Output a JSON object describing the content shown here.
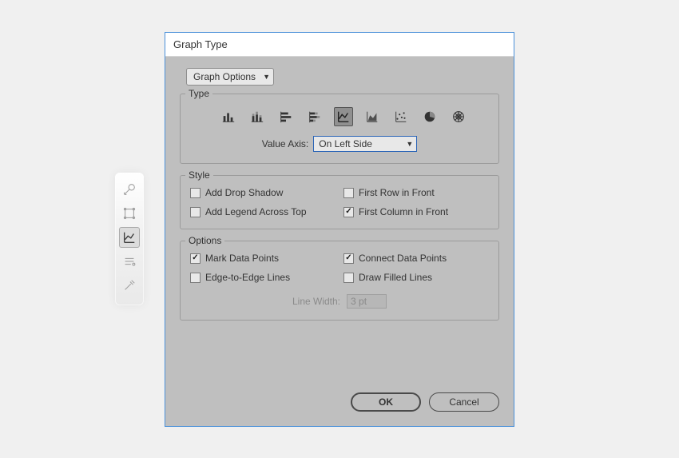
{
  "palette": {
    "tools": [
      {
        "name": "scale-tool-icon"
      },
      {
        "name": "free-transform-tool-icon"
      },
      {
        "name": "line-graph-tool-icon"
      },
      {
        "name": "shape-builder-tool-icon"
      },
      {
        "name": "eyedropper-tool-icon"
      }
    ],
    "selected_index": 2
  },
  "dialog": {
    "title": "Graph Type",
    "top_selector": "Graph Options",
    "type": {
      "legend": "Type",
      "icons": [
        {
          "name": "column-graph-icon"
        },
        {
          "name": "stacked-column-graph-icon"
        },
        {
          "name": "bar-graph-icon"
        },
        {
          "name": "stacked-bar-graph-icon"
        },
        {
          "name": "line-graph-icon"
        },
        {
          "name": "area-graph-icon"
        },
        {
          "name": "scatter-graph-icon"
        },
        {
          "name": "pie-graph-icon"
        },
        {
          "name": "radar-graph-icon"
        }
      ],
      "selected_index": 4,
      "value_axis_label": "Value Axis:",
      "value_axis_value": "On Left Side"
    },
    "style": {
      "legend": "Style",
      "items": [
        {
          "label": "Add Drop Shadow",
          "checked": false
        },
        {
          "label": "First Row in Front",
          "checked": false
        },
        {
          "label": "Add Legend Across Top",
          "checked": false
        },
        {
          "label": "First Column in Front",
          "checked": true
        }
      ]
    },
    "options": {
      "legend": "Options",
      "items": [
        {
          "label": "Mark Data Points",
          "checked": true
        },
        {
          "label": "Connect Data Points",
          "checked": true
        },
        {
          "label": "Edge-to-Edge Lines",
          "checked": false
        },
        {
          "label": "Draw Filled Lines",
          "checked": false
        }
      ],
      "line_width_label": "Line Width:",
      "line_width_value": "3 pt"
    },
    "buttons": {
      "ok": "OK",
      "cancel": "Cancel"
    }
  }
}
